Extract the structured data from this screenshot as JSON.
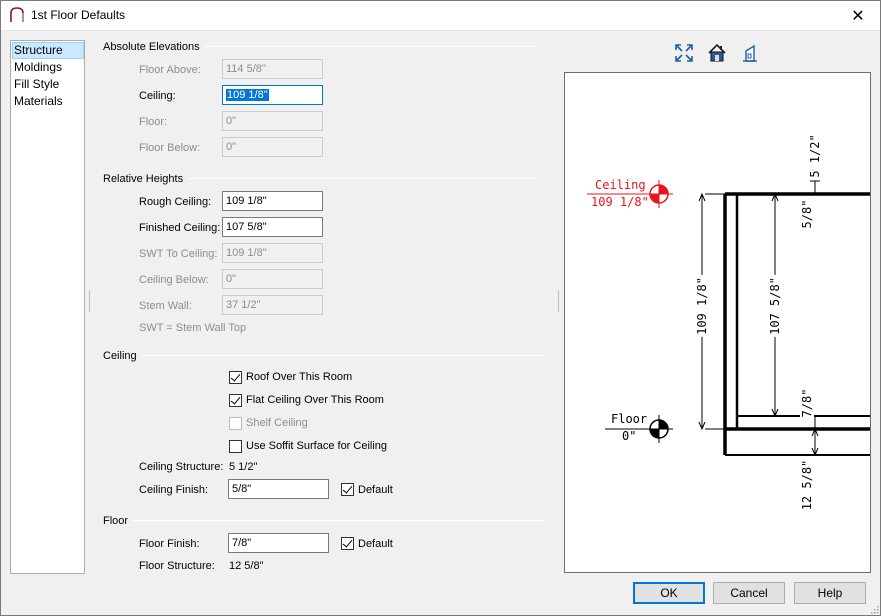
{
  "window": {
    "title": "1st Floor Defaults",
    "close_glyph": "✕"
  },
  "nav": {
    "items": [
      {
        "label": "Structure",
        "selected": true
      },
      {
        "label": "Moldings",
        "selected": false
      },
      {
        "label": "Fill Style",
        "selected": false
      },
      {
        "label": "Materials",
        "selected": false
      }
    ]
  },
  "absolute": {
    "title": "Absolute Elevations",
    "floor_above": {
      "label": "Floor Above:",
      "value": "114 5/8\""
    },
    "ceiling": {
      "label": "Ceiling:",
      "value": "109 1/8\""
    },
    "floor": {
      "label": "Floor:",
      "value": "0\""
    },
    "floor_below": {
      "label": "Floor Below:",
      "value": "0\""
    }
  },
  "relative": {
    "title": "Relative Heights",
    "rough_ceiling": {
      "label": "Rough Ceiling:",
      "value": "109 1/8\""
    },
    "finished_ceiling": {
      "label": "Finished Ceiling:",
      "value": "107 5/8\""
    },
    "swt_to_ceiling": {
      "label": "SWT To Ceiling:",
      "value": "109 1/8\""
    },
    "ceiling_below": {
      "label": "Ceiling Below:",
      "value": "0\""
    },
    "stem_wall": {
      "label": "Stem Wall:",
      "value": "37 1/2\""
    },
    "note": "SWT = Stem Wall Top"
  },
  "ceiling_group": {
    "title": "Ceiling",
    "roof_over": {
      "label": "Roof Over This Room",
      "checked": true
    },
    "flat_ceiling": {
      "label": "Flat Ceiling Over This Room",
      "checked": true
    },
    "shelf_ceiling": {
      "label": "Shelf Ceiling",
      "checked": false
    },
    "soffit": {
      "label": "Use Soffit Surface for Ceiling",
      "checked": false
    },
    "structure": {
      "label": "Ceiling Structure:",
      "value": "5 1/2\""
    },
    "finish": {
      "label": "Ceiling Finish:",
      "value": "5/8\""
    },
    "finish_default": {
      "label": "Default",
      "checked": true
    }
  },
  "floor_group": {
    "title": "Floor",
    "finish": {
      "label": "Floor Finish:",
      "value": "7/8\""
    },
    "finish_default": {
      "label": "Default",
      "checked": true
    },
    "structure": {
      "label": "Floor Structure:",
      "value": "12 5/8\""
    }
  },
  "preview": {
    "tools": [
      "fill-window-icon",
      "house-view-icon",
      "section-view-icon"
    ],
    "ceiling_label": "Ceiling",
    "ceiling_value": "109 1/8\"",
    "floor_label": "Floor",
    "floor_value": "0\"",
    "dim_ceiling_structure": "5 1/2\"",
    "dim_ceiling_finish": "5/8\"",
    "dim_rough": "109 1/8\"",
    "dim_finished": "107 5/8\"",
    "dim_floor_finish": "7/8\"",
    "dim_floor_structure": "12 5/8\"",
    "accent_red": "#e8141c"
  },
  "buttons": {
    "ok": "OK",
    "cancel": "Cancel",
    "help": "Help"
  }
}
